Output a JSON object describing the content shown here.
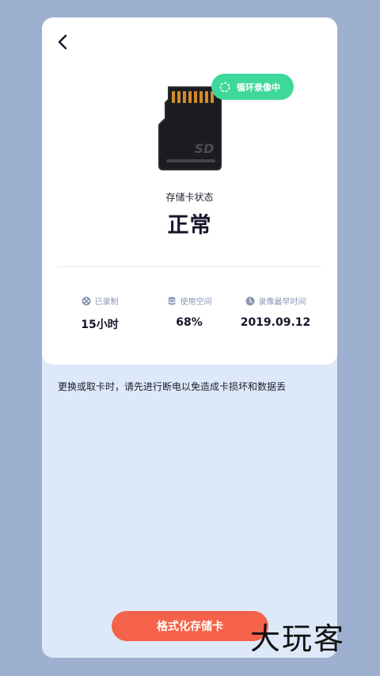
{
  "header": {
    "back_icon": "chevron-left-icon"
  },
  "badge": {
    "label": "循环录像中",
    "icon": "loading-ring-icon",
    "color": "#3ed99a"
  },
  "sd_card": {
    "text": "SD"
  },
  "status": {
    "label": "存储卡状态",
    "value": "正常"
  },
  "stats": [
    {
      "icon": "film-reel-icon",
      "label": "已录制",
      "value": "15小时"
    },
    {
      "icon": "database-icon",
      "label": "使用空间",
      "value": "68%"
    },
    {
      "icon": "clock-icon",
      "label": "录像最早时间",
      "value": "2019.09.12"
    }
  ],
  "notice": "更换或取卡时，请先进行断电以免造成卡损坏和数据丢",
  "format_button": {
    "label": "格式化存储卡",
    "color": "#f5624a"
  },
  "watermark": "大玩客"
}
